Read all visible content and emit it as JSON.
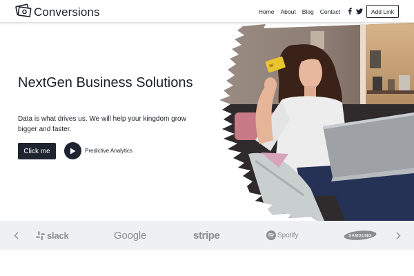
{
  "header": {
    "logo_text": "Conversions",
    "nav": [
      {
        "label": "Home"
      },
      {
        "label": "About"
      },
      {
        "label": "Blog"
      },
      {
        "label": "Contact"
      }
    ],
    "social_icons": [
      "facebook-icon",
      "twitter-icon"
    ],
    "add_link_label": "Add Link"
  },
  "hero": {
    "title": "NextGen Business Solutions",
    "description": "Data is what drives us. We will help your kingdom grow bigger and faster.",
    "primary_button_label": "Click me",
    "secondary_label": "Predictive Analytics",
    "image_description": "woman holding a yellow credit card while using a laptop on a couch"
  },
  "logo_strip": {
    "brands": [
      "slack",
      "Google",
      "stripe",
      "Spotify",
      "SAMSUNG"
    ],
    "prev_icon": "chevron-left-icon",
    "next_icon": "chevron-right-icon"
  },
  "colors": {
    "dark": "#1e2430",
    "strip_bg": "#eff0f1",
    "brand_gray": "#8a8d92",
    "card_yellow": "#e8c52f"
  }
}
